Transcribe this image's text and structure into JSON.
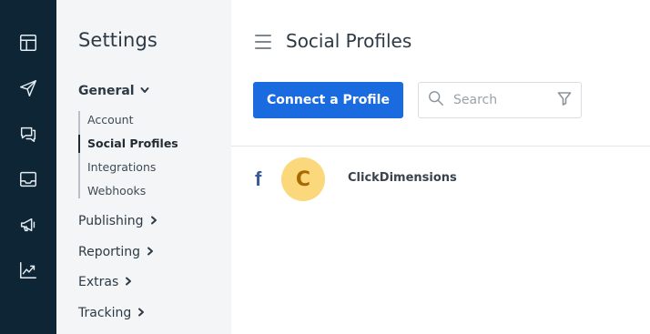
{
  "rail": {
    "items": [
      {
        "name": "layout-icon"
      },
      {
        "name": "send-icon"
      },
      {
        "name": "chat-icon"
      },
      {
        "name": "inbox-icon"
      },
      {
        "name": "megaphone-icon"
      },
      {
        "name": "chart-icon"
      }
    ]
  },
  "sidebar": {
    "title": "Settings",
    "general": {
      "label": "General",
      "items": [
        "Account",
        "Social Profiles",
        "Integrations",
        "Webhooks"
      ],
      "active": "Social Profiles"
    },
    "sections": [
      "Publishing",
      "Reporting",
      "Extras",
      "Tracking"
    ]
  },
  "main": {
    "title": "Social Profiles",
    "connect_button": "Connect a Profile",
    "search_placeholder": "Search",
    "profiles": [
      {
        "network": "f",
        "avatar_letter": "C",
        "name": "ClickDimensions"
      }
    ]
  },
  "colors": {
    "rail_bg": "#0e2535",
    "sidebar_bg": "#f4f5f7",
    "primary": "#1b6be0",
    "facebook": "#3b5998",
    "avatar_bg": "#fcd87c"
  }
}
